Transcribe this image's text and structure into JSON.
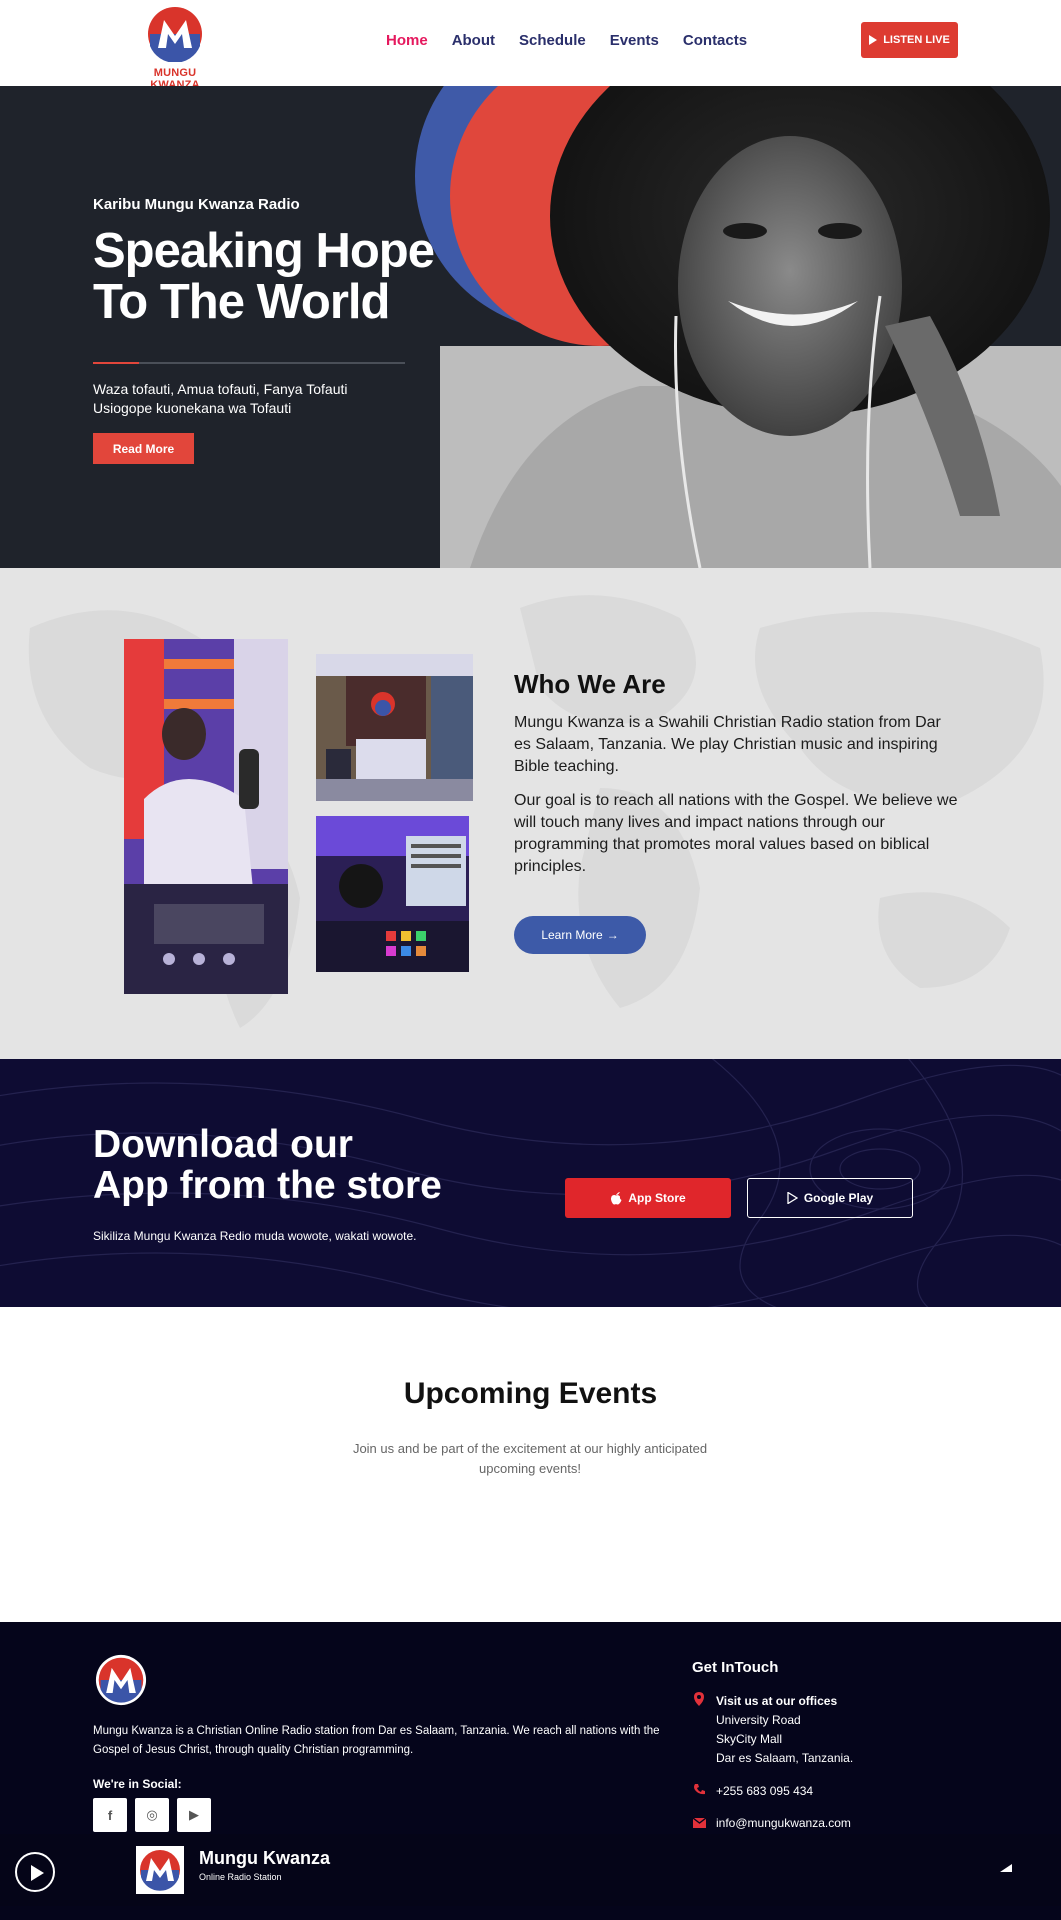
{
  "header": {
    "logo_text": "MUNGU KWANZA",
    "nav": [
      "Home",
      "About",
      "Schedule",
      "Events",
      "Contacts"
    ],
    "active_nav": "Home",
    "listen_live": "LISTEN LIVE"
  },
  "hero": {
    "kicker": "Karibu Mungu Kwanza Radio",
    "title_line1": "Speaking Hope",
    "title_line2": "To The World",
    "sub_line1": "Waza tofauti, Amua tofauti, Fanya Tofauti",
    "sub_line2": "Usiogope kuonekana wa Tofauti",
    "button": "Read More"
  },
  "who": {
    "title": "Who We Are",
    "p1": "Mungu Kwanza is a Swahili Christian Radio station from Dar es Salaam, Tanzania. We play Christian music and inspiring Bible teaching.",
    "p2": "Our goal is to reach all nations with the Gospel. We believe we will touch many lives and impact nations through our programming that promotes moral values based on biblical principles.",
    "button": "Learn More",
    "button_arrow": "→"
  },
  "download": {
    "title_line1": "Download our",
    "title_line2": "App from the store",
    "sub": "Sikiliza Mungu Kwanza Redio muda wowote, wakati wowote.",
    "app_store": "App Store",
    "google_play": "Google Play"
  },
  "events": {
    "title": "Upcoming Events",
    "sub": "Join us and be part of the excitement at our highly anticipated upcoming events!"
  },
  "footer": {
    "about": "Mungu Kwanza is a Christian Online Radio station from Dar es Salaam, Tanzania. We reach all nations with the Gospel of Jesus Christ, through quality Christian programming.",
    "social_heading": "We're in Social:",
    "social": [
      "f",
      "◎",
      "▶"
    ],
    "contact_heading": "Get InTouch",
    "visit_label": "Visit us at our offices",
    "address1": "University Road",
    "address2": "SkyCity Mall",
    "address3": "Dar es Salaam, Tanzania.",
    "phone": "+255 683 095 434",
    "email": "info@mungukwanza.com"
  },
  "player": {
    "station": "Mungu Kwanza",
    "tagline": "Online Radio Station"
  },
  "colors": {
    "accent_red": "#e2463b",
    "nav_blue": "#2a2f6b",
    "active_pink": "#e5195e",
    "learn_blue": "#3d5aa8",
    "download_bg": "#0e0c33",
    "footer_bg": "#05051b"
  }
}
